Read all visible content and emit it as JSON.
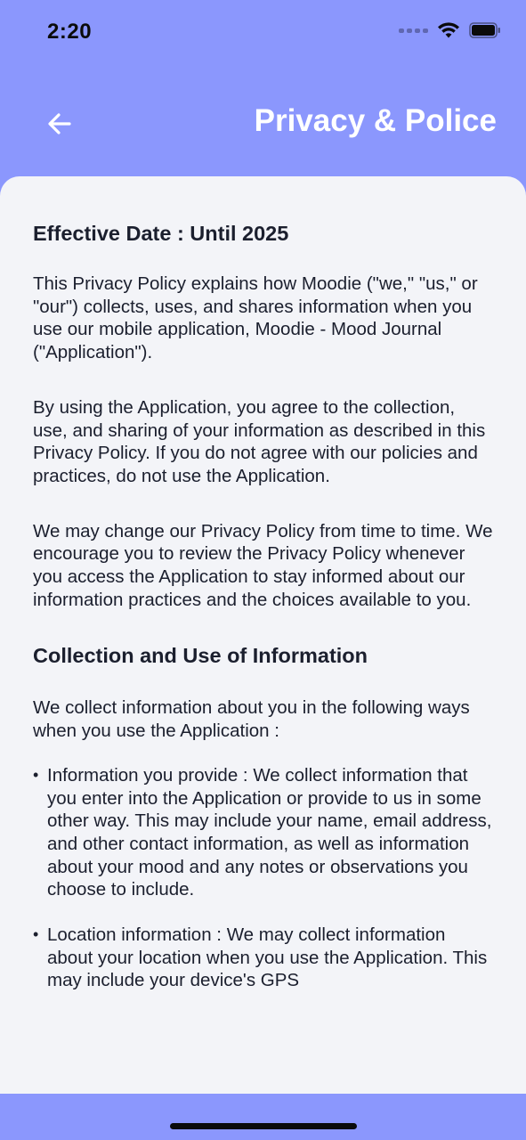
{
  "status_bar": {
    "time": "2:20"
  },
  "header": {
    "title": "Privacy & Police",
    "back_icon": "arrow-left-icon"
  },
  "content": {
    "effective_date": "Effective Date : Until 2025",
    "intro_paragraph": "This Privacy Policy explains how Moodie (\"we,\" \"us,\" or \"our\") collects, uses, and shares information when you use our mobile application, Moodie - Mood Journal (\"Application\").",
    "agreement_paragraph": "By using the Application, you agree to the collection, use, and sharing of your information as described in this Privacy Policy. If you do not agree with our policies and practices, do not use the Application.",
    "changes_paragraph": "We may change our Privacy Policy from time to time. We encourage you to review the Privacy Policy whenever you access the Application to stay informed about our information practices and the choices available to you.",
    "collection_heading": "Collection and Use of Information",
    "collection_intro": "We collect information about you in the following ways when you use the Application :",
    "bullets": [
      {
        "text": "Information you provide : We collect information that you enter into the Application or provide to us in some other way. This may include your name, email address, and other contact information, as well as information about your mood and any notes or observations you choose to include."
      },
      {
        "text": "Location information : We may collect information about your location when you use the Application. This may include your device's GPS"
      }
    ]
  },
  "colors": {
    "accent": "#8b97fd",
    "card_background": "#f3f4f8",
    "text": "#1b1f2e"
  }
}
